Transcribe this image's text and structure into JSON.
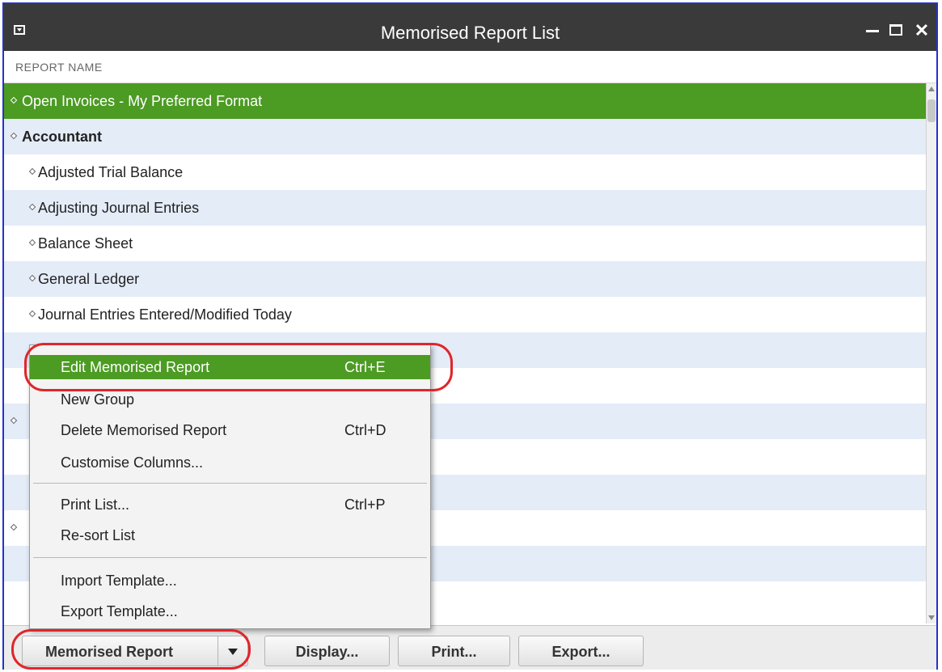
{
  "window": {
    "title": "Memorised Report List"
  },
  "list": {
    "column_header": "REPORT NAME",
    "rows": [
      {
        "label": "Open Invoices - My Preferred Format"
      },
      {
        "label": "Accountant"
      },
      {
        "label": "Adjusted Trial Balance"
      },
      {
        "label": "Adjusting Journal Entries"
      },
      {
        "label": "Balance Sheet"
      },
      {
        "label": "General Ledger"
      },
      {
        "label": "Journal Entries Entered/Modified Today"
      },
      {
        "label": ""
      },
      {
        "label": ""
      },
      {
        "label": ""
      },
      {
        "label": ""
      },
      {
        "label": ""
      },
      {
        "label": ""
      },
      {
        "label": ""
      },
      {
        "label": ""
      }
    ]
  },
  "context_menu": {
    "items": [
      {
        "label": "Edit Memorised Report",
        "shortcut": "Ctrl+E"
      },
      {
        "label": "New Group",
        "shortcut": ""
      },
      {
        "label": "Delete Memorised Report",
        "shortcut": "Ctrl+D"
      },
      {
        "label": "Customise Columns...",
        "shortcut": ""
      },
      {
        "label": "Print List...",
        "shortcut": "Ctrl+P"
      },
      {
        "label": "Re-sort List",
        "shortcut": ""
      },
      {
        "label": "Import Template...",
        "shortcut": ""
      },
      {
        "label": "Export Template...",
        "shortcut": ""
      }
    ]
  },
  "toolbar": {
    "memorised_report_label": "Memorised Report",
    "display_label": "Display...",
    "print_label": "Print...",
    "export_label": "Export..."
  },
  "colors": {
    "selection_green": "#4c9b23",
    "title_bar": "#3a3a3a",
    "row_stripe": "#e4ecf8",
    "annotation_red": "#e0262a"
  }
}
